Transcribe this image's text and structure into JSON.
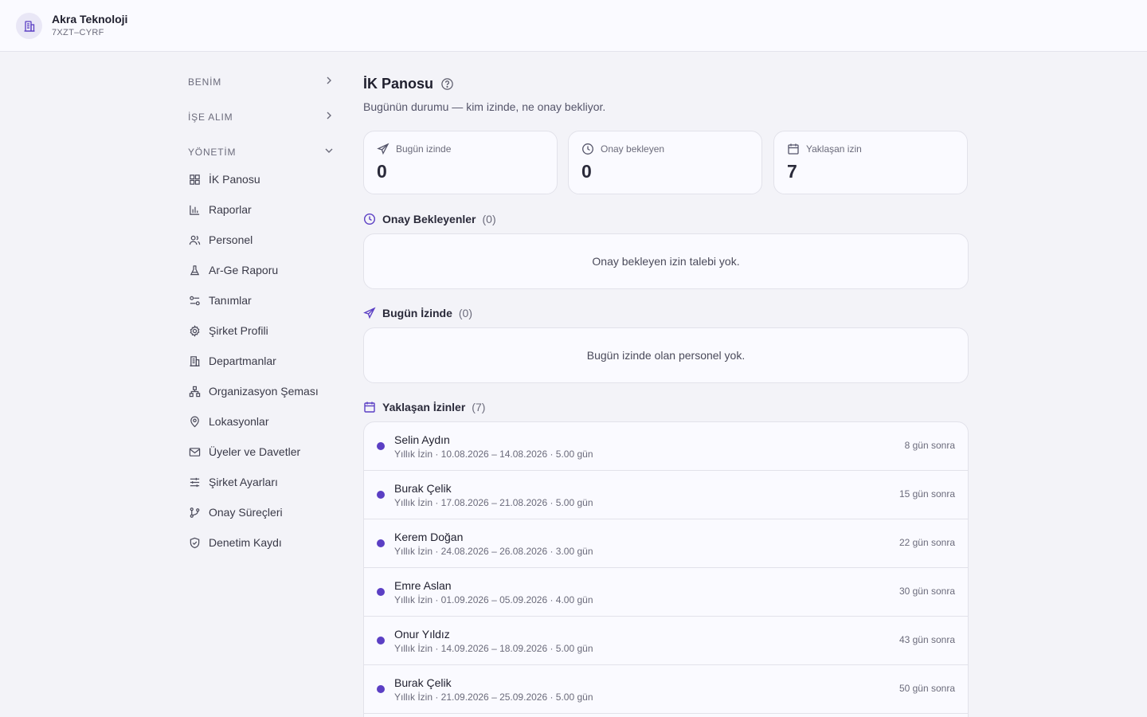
{
  "header": {
    "org_name": "Akra Teknoloji",
    "org_code": "7XZT–CYRF"
  },
  "sidebar": {
    "sections": [
      {
        "label": "BENİM",
        "expanded": false
      },
      {
        "label": "İŞE ALIM",
        "expanded": false
      },
      {
        "label": "YÖNETİM",
        "expanded": true
      }
    ],
    "items": [
      {
        "label": "İK Panosu",
        "icon": "dashboard-icon"
      },
      {
        "label": "Raporlar",
        "icon": "bar-chart-icon"
      },
      {
        "label": "Personel",
        "icon": "users-icon"
      },
      {
        "label": "Ar-Ge Raporu",
        "icon": "flask-icon"
      },
      {
        "label": "Tanımlar",
        "icon": "settings-sliders-icon"
      },
      {
        "label": "Şirket Profili",
        "icon": "gear-icon"
      },
      {
        "label": "Departmanlar",
        "icon": "building-icon"
      },
      {
        "label": "Organizasyon Şeması",
        "icon": "org-chart-icon"
      },
      {
        "label": "Lokasyonlar",
        "icon": "map-pin-icon"
      },
      {
        "label": "Üyeler ve Davetler",
        "icon": "mail-icon"
      },
      {
        "label": "Şirket Ayarları",
        "icon": "sliders-icon"
      },
      {
        "label": "Onay Süreçleri",
        "icon": "git-branch-icon"
      },
      {
        "label": "Denetim Kaydı",
        "icon": "shield-check-icon"
      }
    ]
  },
  "main": {
    "title": "İK Panosu",
    "subtitle": "Bugünün durumu — kim izinde, ne onay bekliyor.",
    "stats": [
      {
        "label": "Bugün izinde",
        "value": "0",
        "icon": "plane-icon"
      },
      {
        "label": "Onay bekleyen",
        "value": "0",
        "icon": "clock-icon"
      },
      {
        "label": "Yaklaşan izin",
        "value": "7",
        "icon": "calendar-icon"
      }
    ],
    "pending": {
      "title": "Onay Bekleyenler",
      "count": "(0)",
      "empty_text": "Onay bekleyen izin talebi yok."
    },
    "on_leave": {
      "title": "Bugün İzinde",
      "count": "(0)",
      "empty_text": "Bugün izinde olan personel yok."
    },
    "upcoming": {
      "title": "Yaklaşan İzinler",
      "count": "(7)",
      "rows": [
        {
          "name": "Selin Aydın",
          "meta": "Yıllık İzin · 10.08.2026 – 14.08.2026 · 5.00 gün",
          "when": "8 gün sonra"
        },
        {
          "name": "Burak Çelik",
          "meta": "Yıllık İzin · 17.08.2026 – 21.08.2026 · 5.00 gün",
          "when": "15 gün sonra"
        },
        {
          "name": "Kerem Doğan",
          "meta": "Yıllık İzin · 24.08.2026 – 26.08.2026 · 3.00 gün",
          "when": "22 gün sonra"
        },
        {
          "name": "Emre Aslan",
          "meta": "Yıllık İzin · 01.09.2026 – 05.09.2026 · 4.00 gün",
          "when": "30 gün sonra"
        },
        {
          "name": "Onur Yıldız",
          "meta": "Yıllık İzin · 14.09.2026 – 18.09.2026 · 5.00 gün",
          "when": "43 gün sonra"
        },
        {
          "name": "Burak Çelik",
          "meta": "Yıllık İzin · 21.09.2026 – 25.09.2026 · 5.00 gün",
          "when": "50 gün sonra"
        }
      ]
    }
  },
  "colors": {
    "accent": "#5b3fc4",
    "background": "#f3f3f8",
    "card": "#fafaff"
  }
}
